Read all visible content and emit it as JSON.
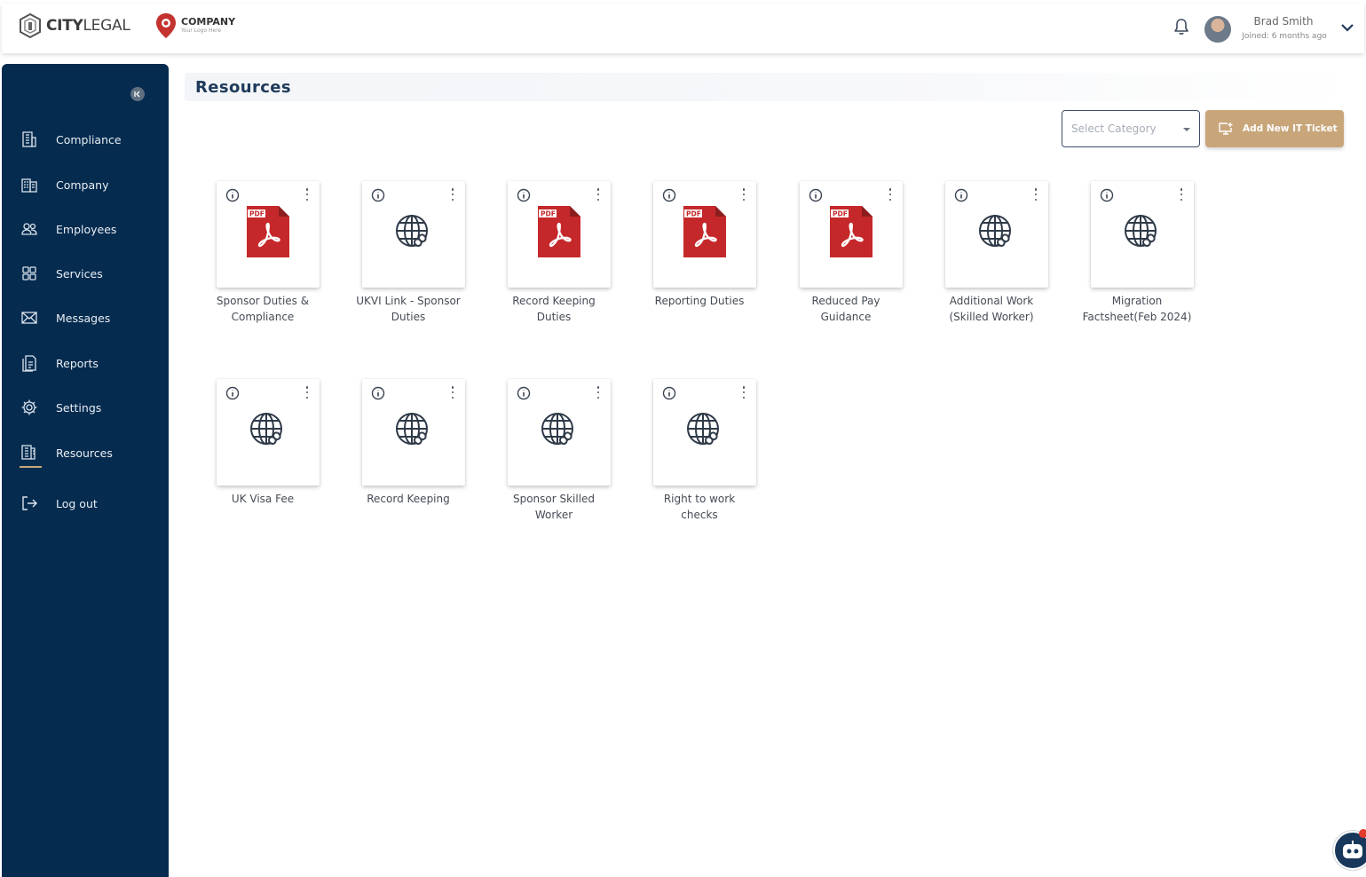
{
  "header": {
    "brand": {
      "prefix": "CITY",
      "suffix": "LEGAL"
    },
    "company": {
      "name": "COMPANY",
      "tagline": "Your Logo Here"
    },
    "user": {
      "name": "Brad Smith",
      "joined": "Joined: 6 months ago"
    }
  },
  "sidebar": {
    "items": [
      {
        "label": "Compliance",
        "icon": "building-icon"
      },
      {
        "label": "Company",
        "icon": "office-icon"
      },
      {
        "label": "Employees",
        "icon": "users-icon"
      },
      {
        "label": "Services",
        "icon": "grid-icon"
      },
      {
        "label": "Messages",
        "icon": "mail-icon"
      },
      {
        "label": "Reports",
        "icon": "reports-icon"
      },
      {
        "label": "Settings",
        "icon": "gear-icon"
      },
      {
        "label": "Resources",
        "icon": "resources-icon",
        "active": true
      },
      {
        "label": "Log out",
        "icon": "logout-icon"
      }
    ]
  },
  "main": {
    "title": "Resources",
    "category_placeholder": "Select Category",
    "ticket_button": "Add New IT Ticket",
    "resources": [
      {
        "title": "Sponsor Duties & Compliance",
        "type": "pdf"
      },
      {
        "title": "UKVI Link - Sponsor Duties",
        "type": "link"
      },
      {
        "title": "Record Keeping Duties",
        "type": "pdf"
      },
      {
        "title": "Reporting Duties",
        "type": "pdf"
      },
      {
        "title": "Reduced Pay Guidance",
        "type": "pdf"
      },
      {
        "title": "Additional Work (Skilled Worker)",
        "type": "link"
      },
      {
        "title": "Migration Factsheet(Feb 2024)",
        "type": "link"
      },
      {
        "title": "UK Visa Fee",
        "type": "link"
      },
      {
        "title": "Record Keeping",
        "type": "link"
      },
      {
        "title": "Sponsor Skilled Worker",
        "type": "link"
      },
      {
        "title": "Right to work checks",
        "type": "link"
      }
    ]
  },
  "colors": {
    "sidebar_bg": "#052b4f",
    "accent": "#c8a67a",
    "pdf_red": "#c5282a"
  }
}
